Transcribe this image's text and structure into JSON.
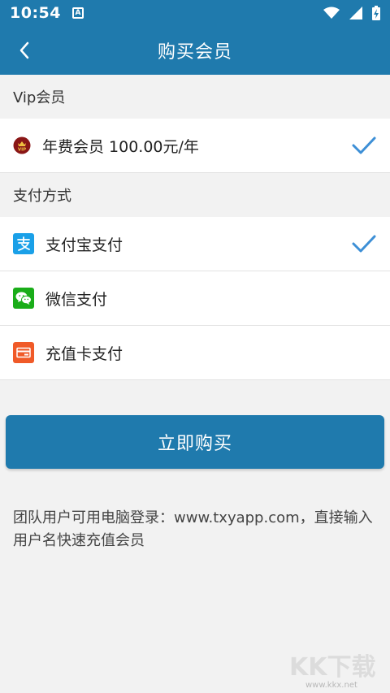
{
  "status_bar": {
    "time": "10:54",
    "notification_letter": "A"
  },
  "app_bar": {
    "title": "购买会员"
  },
  "vip_section": {
    "header": "Vip会员",
    "option": {
      "label": "年费会员 100.00元/年",
      "selected": true
    }
  },
  "payment_section": {
    "header": "支付方式",
    "methods": [
      {
        "label": "支付宝支付",
        "icon": "alipay-icon",
        "color": "#1aa0e8",
        "selected": true
      },
      {
        "label": "微信支付",
        "icon": "wechat-icon",
        "color": "#1aad19",
        "selected": false
      },
      {
        "label": "充值卡支付",
        "icon": "card-icon",
        "color": "#f05a28",
        "selected": false
      }
    ]
  },
  "buy_button": {
    "label": "立即购买"
  },
  "note": {
    "text": "团队用户可用电脑登录：www.txyapp.com，直接输入用户名快速充值会员"
  },
  "watermark": {
    "brand": "KK下载",
    "url": "www.kkx.net"
  },
  "colors": {
    "primary": "#1f7aad",
    "check": "#3d8fd6",
    "background": "#f2f2f2"
  }
}
